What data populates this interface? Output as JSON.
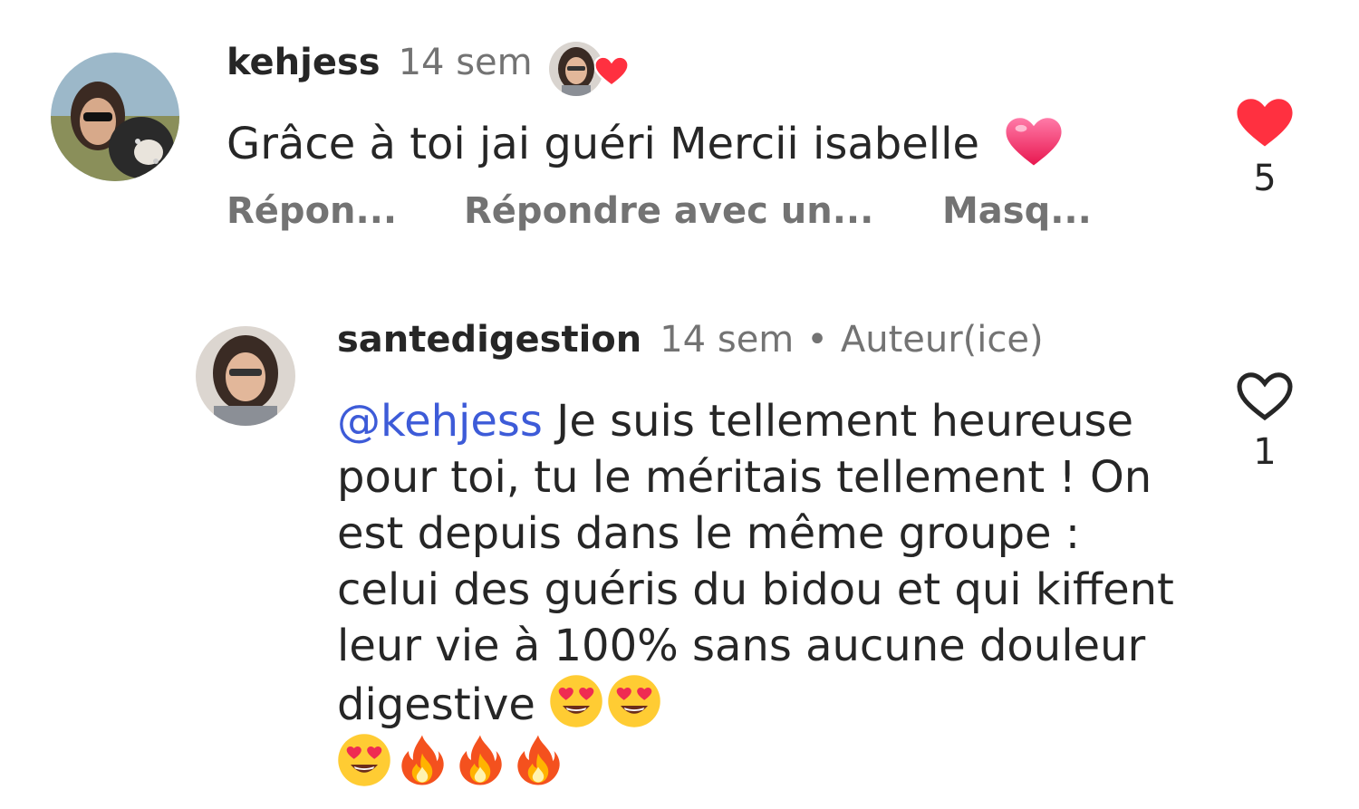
{
  "comment": {
    "username": "kehjess",
    "time": "14 sem",
    "text": "Grâce à toi jai guéri Mercii isabelle",
    "text_emoji": "red-heart",
    "actions": {
      "reply": "Répon...",
      "reply_sticker": "Répondre avec un...",
      "hide": "Masq..."
    },
    "like_count": "5",
    "liked": true,
    "liked_by_author": true
  },
  "reply": {
    "username": "santedigestion",
    "time": "14 sem",
    "separator": "•",
    "badge": "Auteur(ice)",
    "mention": "@kehjess",
    "text": " Je suis tellement heureuse pour toi, tu le méritais tellement ! On est depuis dans le même groupe : celui des guéris du bidou et qui kiffent leur vie à 100% sans aucune douleur digestive ",
    "text_emojis": [
      "heart-eyes",
      "heart-eyes",
      "heart-eyes",
      "fire",
      "fire",
      "fire"
    ],
    "like_count": "1",
    "liked": false
  },
  "colors": {
    "text": "#262626",
    "secondary": "#737373",
    "mention": "#3d5bd8",
    "like_red": "#ff3040"
  }
}
